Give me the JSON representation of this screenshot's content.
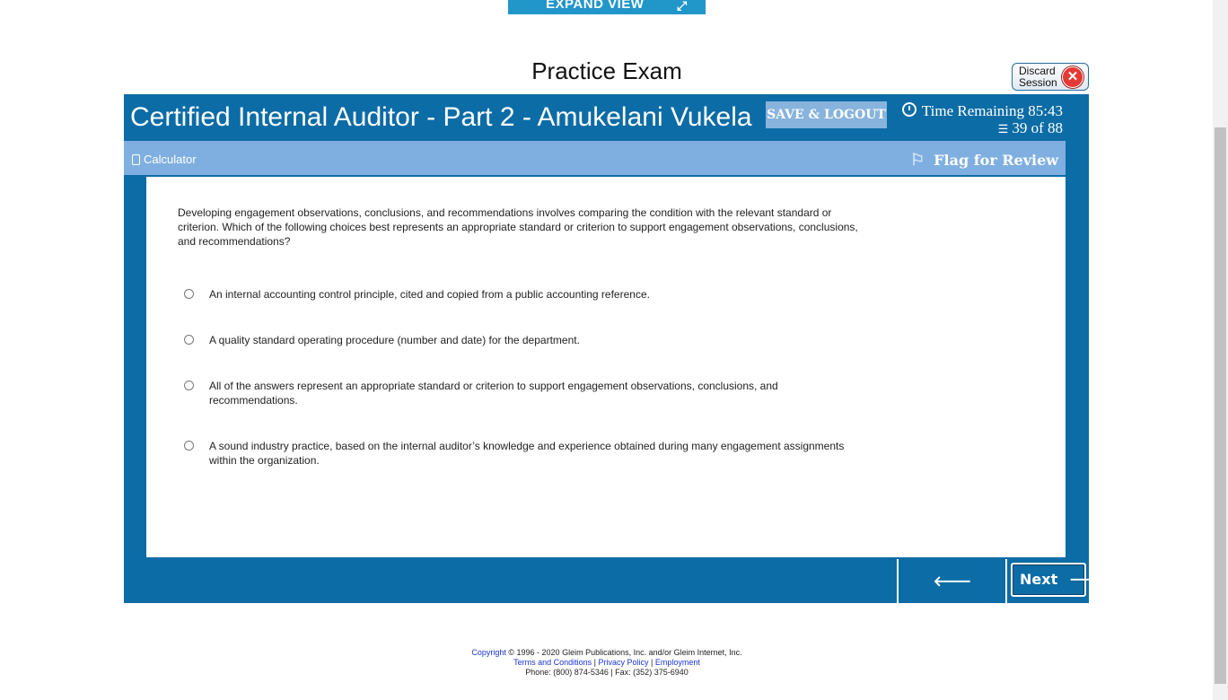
{
  "header": {
    "expand_label": "EXPAND VIEW",
    "page_title": "Practice Exam",
    "discard_label": "Discard Session"
  },
  "exam": {
    "title": "Certified Internal Auditor - Part 2 - Amukelani Vukela",
    "save_logout_label": "SAVE & LOGOUT",
    "time_remaining": "Time Remaining 85:43",
    "question_count": "39 of 88"
  },
  "toolbar": {
    "calculator_label": "Calculator",
    "flag_label": "Flag for Review"
  },
  "question": {
    "stem": "Developing engagement observations, conclusions, and recommendations involves comparing the condition with the relevant standard or criterion. Which of the following choices best represents an appropriate standard or criterion to support engagement observations, conclusions, and recommendations?",
    "choices": [
      {
        "text": "An internal accounting control principle, cited and copied from a public accounting reference."
      },
      {
        "text": "A quality standard operating procedure (number and date) for the department."
      },
      {
        "text": "All of the answers represent an appropriate standard or criterion to support engagement observations, conclusions, and recommendations."
      },
      {
        "text": "A sound industry practice, based on the internal auditor’s knowledge and experience obtained during many engagement assignments within the organization."
      }
    ]
  },
  "navigation": {
    "previous_label": "Previous",
    "next_label": "Next"
  },
  "footer": {
    "copyright_link": "Copyright",
    "copyright_text": "© 1996 - 2020 Gleim Publications, Inc. and/or Gleim Internet, Inc.",
    "terms_link": "Terms and Conditions",
    "privacy_link": "Privacy Policy",
    "employment_link": "Employment",
    "separator": "|",
    "phone": "Phone: (800) 874-5346 | Fax: (352) 375-6940"
  },
  "colors": {
    "primary_blue": "#0c6ca6",
    "toolbar_blue": "#7fafe0",
    "expand_blue": "#2196c8",
    "discard_red": "#e53935"
  }
}
